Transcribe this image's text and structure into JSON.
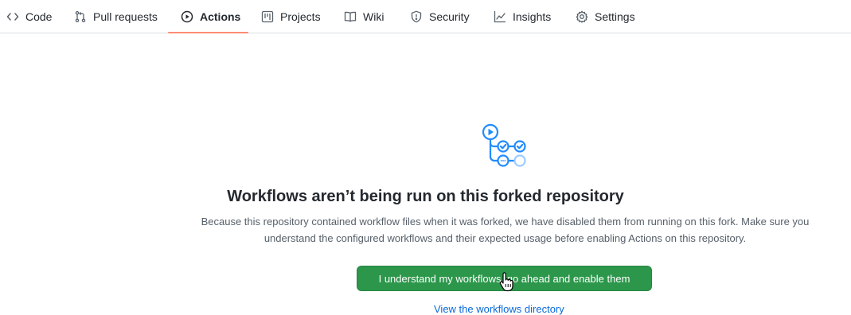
{
  "nav": {
    "tabs": [
      {
        "label": "Code",
        "icon": "code-icon"
      },
      {
        "label": "Pull requests",
        "icon": "pull-request-icon"
      },
      {
        "label": "Actions",
        "icon": "play-icon",
        "active": true
      },
      {
        "label": "Projects",
        "icon": "project-icon"
      },
      {
        "label": "Wiki",
        "icon": "book-icon"
      },
      {
        "label": "Security",
        "icon": "shield-icon"
      },
      {
        "label": "Insights",
        "icon": "graph-icon"
      },
      {
        "label": "Settings",
        "icon": "gear-icon"
      }
    ],
    "active_underline_color": "#fd8c73"
  },
  "main": {
    "icon": "workflow-icon",
    "title": "Workflows aren’t being run on this forked repository",
    "description_line1": "Because this repository contained workflow files when it was forked, we have disabled them from running on this fork. Make sure you",
    "description_line2": "understand the configured workflows and their expected usage before enabling Actions on this repository.",
    "button_label": "I understand my workflows, go ahead and enable them",
    "button_color": "#2c974b",
    "link_label": "View the workflows directory"
  }
}
